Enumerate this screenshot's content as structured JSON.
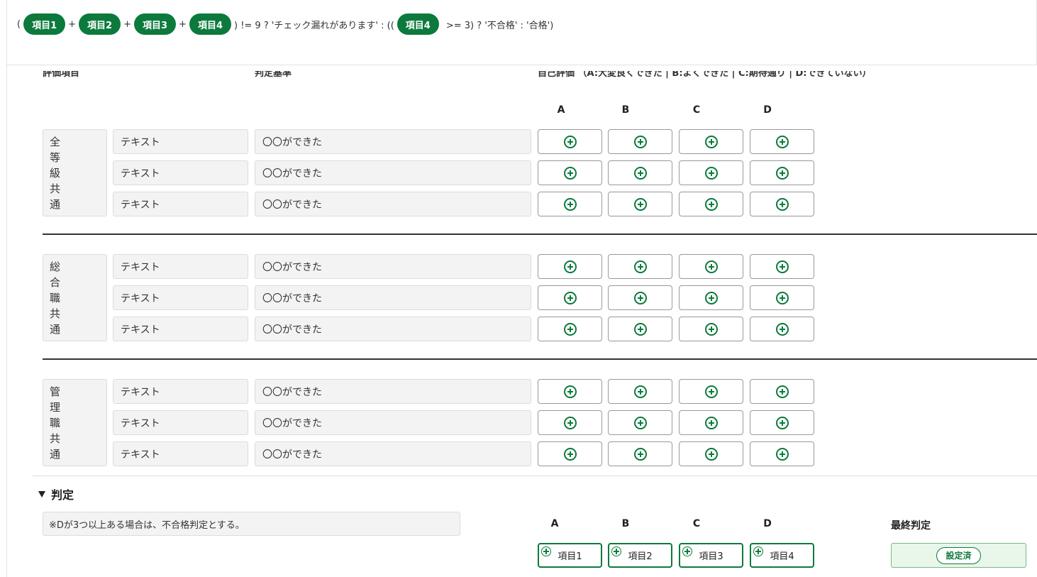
{
  "formula": {
    "open": "(",
    "pill1": "項目1",
    "plus1": "+",
    "pill2": "項目2",
    "plus2": "+",
    "pill3": "項目3",
    "plus3": "+",
    "pill4": "項目4",
    "mid": ") != 9 ? 'チェック漏れがあります' : ((",
    "pill5": "項目4",
    "tail": ">= 3) ? '不合格' : '合格')"
  },
  "table": {
    "header_item": "評価項目",
    "header_criteria": "判定基準",
    "header_self": "自己評価 （A:大変良くできた | B:よくできた | C:期待通り | D:できていない）",
    "columns": [
      "A",
      "B",
      "C",
      "D"
    ],
    "groups": [
      {
        "label": [
          "全",
          "等",
          "級",
          "共",
          "通"
        ],
        "rows": [
          {
            "item": "テキスト",
            "criteria": "〇〇ができた"
          },
          {
            "item": "テキスト",
            "criteria": "〇〇ができた"
          },
          {
            "item": "テキスト",
            "criteria": "〇〇ができた"
          }
        ]
      },
      {
        "label": [
          "総",
          "合",
          "職",
          "共",
          "通"
        ],
        "rows": [
          {
            "item": "テキスト",
            "criteria": "〇〇ができた"
          },
          {
            "item": "テキスト",
            "criteria": "〇〇ができた"
          },
          {
            "item": "テキスト",
            "criteria": "〇〇ができた"
          }
        ]
      },
      {
        "label": [
          "管",
          "理",
          "職",
          "共",
          "通"
        ],
        "rows": [
          {
            "item": "テキスト",
            "criteria": "〇〇ができた"
          },
          {
            "item": "テキスト",
            "criteria": "〇〇ができた"
          },
          {
            "item": "テキスト",
            "criteria": "〇〇ができた"
          }
        ]
      }
    ]
  },
  "judgement": {
    "title": "判定",
    "note": "※Dが3つ以上ある場合は、不合格判定とする。",
    "columns": [
      "A",
      "B",
      "C",
      "D"
    ],
    "items": [
      "項目1",
      "項目2",
      "項目3",
      "項目4"
    ],
    "final_label": "最終判定",
    "final_value": "設定済"
  },
  "colors": {
    "accent": "#0c7a3c",
    "final_bg": "#e9f6ea"
  }
}
